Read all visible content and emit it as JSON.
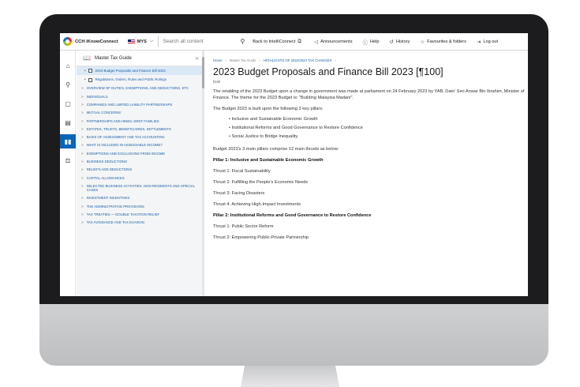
{
  "topbar": {
    "brand": "CCH iKnowConnect",
    "country": "MYS",
    "search_placeholder": "Search all content",
    "links": [
      {
        "label": "Back to IntelliConnect",
        "icon": "external-link-icon"
      },
      {
        "label": "Announcements",
        "icon": "megaphone-icon"
      },
      {
        "label": "Help",
        "icon": "help-icon"
      },
      {
        "label": "History",
        "icon": "history-icon"
      },
      {
        "label": "Favourites & folders",
        "icon": "star-icon"
      },
      {
        "label": "Log out",
        "icon": "logout-icon"
      }
    ]
  },
  "sidebar": {
    "title": "Master Tax Guide",
    "sub_items": [
      {
        "label": "2023 Budget Proposals and Finance Bill 2023",
        "active": true
      },
      {
        "label": "Regulations, Orders, Rules and Public Rulings",
        "active": false
      }
    ],
    "items": [
      "OVERVIEW OF DUTIES, EXEMPTIONS, AND DEDUCTIONS, ETC",
      "INDIVIDUALS",
      "COMPANIES AND LIMITED LIABILITY PARTNERSHIPS",
      "MUTUAL CONCERNS",
      "PARTNERSHIPS AND HINDU JOINT FAMILIES",
      "ESTATES, TRUSTS, BENEFICIARIES, SETTLEMENTS",
      "BASIS OF ASSESSMENT AND TAX ACCOUNTING",
      "WHAT IS INCLUDED IN ASSESSABLE INCOME?",
      "EXEMPTIONS AND EXCLUSIONS FROM INCOME",
      "BUSINESS DEDUCTIONS",
      "RELIEFS AND DEDUCTIONS",
      "CAPITAL ALLOWANCES",
      "SELECTED BUSINESS ACTIVITIES, NON-RESIDENTS AND SPECIAL CASES",
      "INVESTMENT INCENTIVES",
      "THE ADMINISTRATIVE PROVISIONS",
      "TAX TREATIES — DOUBLE TAXATION RELIEF",
      "TAX AVOIDANCE AND TAX EVASION"
    ]
  },
  "breadcrumb": [
    "Home",
    "Master Tax Guide",
    "HIGHLIGHTS OF 2022/2023 TAX CHANGES"
  ],
  "content": {
    "title": "2023 Budget Proposals and Finance Bill 2023 [¶100]",
    "para_ref": "¶100",
    "intro": "The retabling of the 2023 Budget upon a change in government was made at parliament on 24 February 2023 by YAB, Dato' Seri Anwar Bin Ibrahim, Minister of Finance. The theme for the 2023 Budget is: \"Building Malaysia Madani\".",
    "pillars_intro": "The Budget 2023 is built upon the following 3 key pillars:",
    "pillars": [
      "Inclusive and Sustainable Economic Growth",
      "Institutional Reforms and Good Governance to Restore Confidence",
      "Social Justice to Bridge Inequality."
    ],
    "thrusts_intro": "Budget 2023's 3 main pillars comprise 12 main thrusts as below:",
    "pillar1_heading": "Pillar 1: Inclusive and Sustainable Economic Growth",
    "thrust1": "Thrust 1: Fiscal Sustainability",
    "thrust2": "Thrust 2: Fulfilling the People's Economic Needs",
    "thrust3": "Thrust 3: Facing Disasters",
    "thrust4": "Thrust 4: Achieving High-Impact Investments",
    "pillar2_heading": "Pillar 2: Institutional Reforms and Good Governance to Restore Confidence",
    "p2_thrust1": "Thrust 1: Public Sector Reform",
    "p2_thrust2": "Thrust 2: Empowering Public-Private Partnership"
  }
}
